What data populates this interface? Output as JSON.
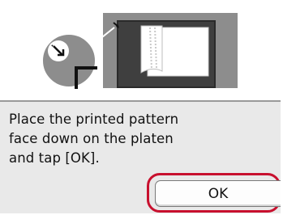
{
  "dialog": {
    "message": "Place the printed pattern\nface down on the platen\nand tap [OK].",
    "ok_label": "OK"
  },
  "illustration": {
    "name": "place-pattern-on-platen",
    "icons": [
      "corner-alignment-marker-icon",
      "arrow-to-corner-icon",
      "printed-sheet-icon"
    ]
  },
  "colors": {
    "illustration_frame": "#8d8d8d",
    "platen": "#3f3f3f",
    "sheet": "#ffffff",
    "message_background": "#e9e9e9",
    "highlight": "#c8102e"
  }
}
